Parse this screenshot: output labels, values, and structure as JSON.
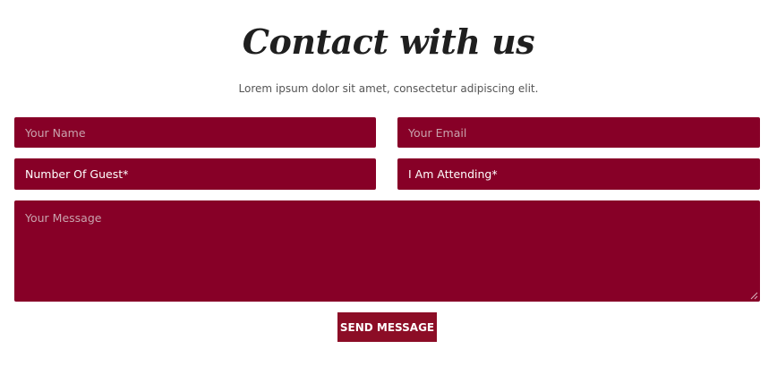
{
  "header": {
    "title": "Contact with us",
    "subtitle": "Lorem ipsum dolor sit amet, consectetur adipiscing elit."
  },
  "form": {
    "name_placeholder": "Your Name",
    "email_placeholder": "Your Email",
    "guest_select": "Number Of Guest*",
    "attending_select": "I Am Attending*",
    "message_placeholder": "Your Message",
    "submit_label": "SEND MESSAGE"
  },
  "colors": {
    "field_bg": "#870027",
    "button_bg": "#8c0d26",
    "title": "#1f1f1f",
    "subtitle": "#555555"
  }
}
